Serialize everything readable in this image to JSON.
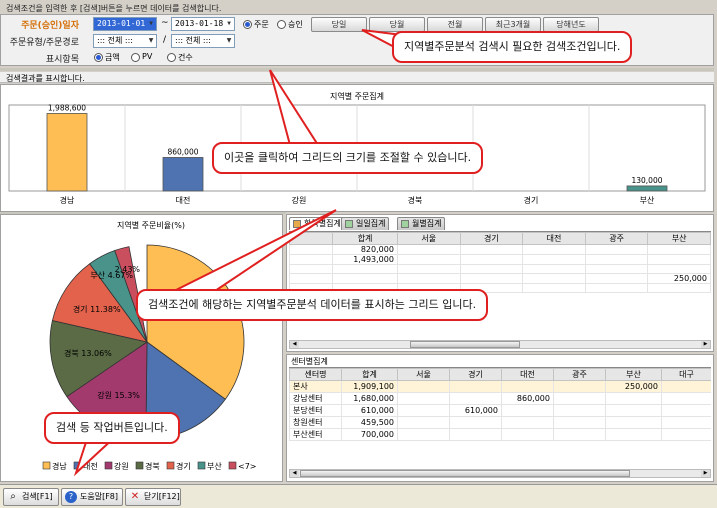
{
  "hint_top": "검색조건을 입력한 후 [검색]버튼을 누르면 데이터를 검색합니다.",
  "conditions": {
    "date_label": "주문(승인)일자",
    "date_from": "2013-01-01",
    "date_sep": "~",
    "date_to": "2013-01-18",
    "date_radios": [
      {
        "label": "주문",
        "checked": true
      },
      {
        "label": "승인",
        "checked": false
      }
    ],
    "quick_buttons": [
      "당일",
      "당월",
      "전월",
      "최근3개월",
      "당해년도"
    ],
    "order_type_label": "주문유형/주문경로",
    "order_type_value": "::: 전체 :::",
    "order_sep": "/",
    "order_route_value": "::: 전체 :::",
    "display_label": "표시항목",
    "display_radios": [
      {
        "label": "금액",
        "checked": true
      },
      {
        "label": "PV",
        "checked": false
      },
      {
        "label": "건수",
        "checked": false
      }
    ]
  },
  "result_hint": "검색결과를 표시합니다.",
  "chart_data": [
    {
      "type": "bar",
      "title": "지역별 주문집계",
      "categories": [
        "경남",
        "대전",
        "강원",
        "경북",
        "경기",
        "부산"
      ],
      "values": [
        1988600,
        860000,
        null,
        null,
        null,
        130000
      ],
      "value_labels": [
        "1,988,600",
        "860,000",
        "",
        "",
        "",
        "130,000"
      ],
      "colors": [
        "#ffbe53",
        "#4e73b0",
        "#a33a6e",
        "#5a6b45",
        "#e2624c",
        "#4a938a"
      ],
      "ylim": [
        0,
        2000000
      ],
      "grid": true
    },
    {
      "type": "pie",
      "title": "지역별 주문비율(%)",
      "slices": [
        {
          "label": "경남",
          "percent": 35.04,
          "color": "#ffbe53"
        },
        {
          "label": "대전",
          "percent": 15.15,
          "color": "#4e73b0"
        },
        {
          "label": "강원",
          "percent": 15.3,
          "color": "#a33a6e"
        },
        {
          "label": "경북",
          "percent": 13.06,
          "color": "#5a6b45"
        },
        {
          "label": "경기",
          "percent": 11.38,
          "color": "#e2624c"
        },
        {
          "label": "부산",
          "percent": 4.67,
          "color": "#4a938a"
        },
        {
          "label": "<7>",
          "percent": 2.43,
          "color": "#c94f5f"
        }
      ],
      "slice_labels": [
        "강원 15.3%",
        "경북 13.06%",
        "경기 11.38%",
        "부산 4.67%",
        "2.43%"
      ],
      "legend": [
        "경남",
        "대전",
        "강원",
        "경북",
        "경기",
        "부산",
        "<7>"
      ]
    }
  ],
  "grid1": {
    "tabs": [
      {
        "label": "항목별집계",
        "active": true
      },
      {
        "label": "일일집계",
        "active": false
      },
      {
        "label": "월별집계",
        "active": false
      }
    ],
    "columns": [
      "",
      "합계",
      "서울",
      "경기",
      "대전",
      "광주",
      "부산"
    ],
    "rows": [
      [
        "",
        "820,000",
        "",
        "",
        "",
        "",
        ""
      ],
      [
        "",
        "1,493,000",
        "",
        "",
        "",
        "",
        ""
      ],
      [
        "",
        "",
        "",
        "",
        "",
        "",
        ""
      ],
      [
        "",
        "",
        "",
        "",
        "",
        "",
        "250,000"
      ],
      [
        "",
        "",
        "",
        "",
        "",
        "",
        ""
      ]
    ]
  },
  "grid2": {
    "title": "센터별집계",
    "columns": [
      "센터명",
      "합계",
      "서울",
      "경기",
      "대전",
      "광주",
      "부산",
      "대구"
    ],
    "rows": [
      [
        "본사",
        "1,909,100",
        "",
        "",
        "",
        "",
        "250,000",
        ""
      ],
      [
        "강남센터",
        "1,680,000",
        "",
        "",
        "860,000",
        "",
        "",
        ""
      ],
      [
        "분당센터",
        "610,000",
        "",
        "610,000",
        "",
        "",
        "",
        ""
      ],
      [
        "창원센터",
        "459,500",
        "",
        "",
        "",
        "",
        "",
        ""
      ],
      [
        "부산센터",
        "700,000",
        "",
        "",
        "",
        "",
        "",
        ""
      ]
    ]
  },
  "footer": {
    "search": "검색[F1]",
    "help": "도움말[F8]",
    "close": "닫기[F12]"
  },
  "callouts": {
    "search_cond": "지역별주문분석 검색시 필요한 검색조건입니다.",
    "grid_resize": "이곳을 클릭하여 그리드의 크기를 조절할 수 있습니다.",
    "grid_desc": "검색조건에 해당하는 지역별주문분석 데이터를 표시하는 그리드 입니다.",
    "buttons": "검색 등 작업버튼입니다."
  }
}
